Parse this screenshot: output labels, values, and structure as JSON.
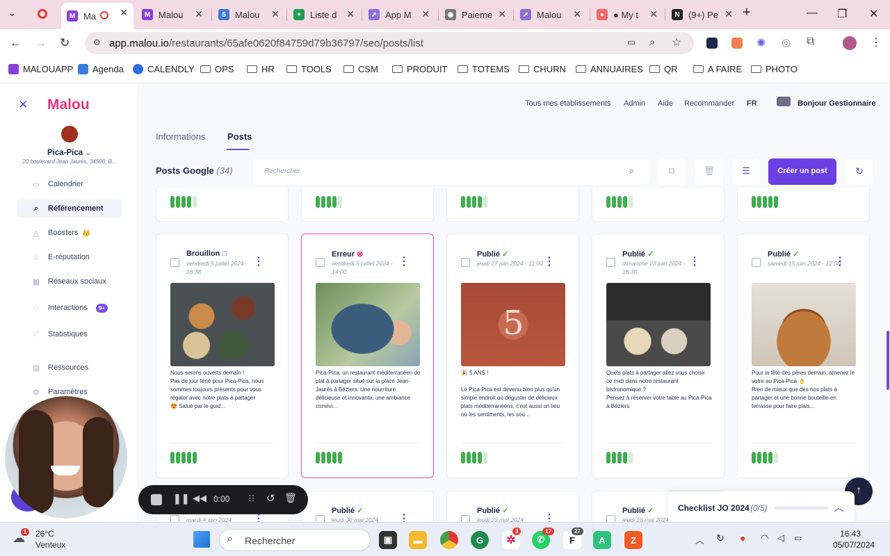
{
  "browser": {
    "tabs": [
      {
        "title": "Ma",
        "fav": "M",
        "color": "#8b3fd9",
        "active": true
      },
      {
        "title": "Malou",
        "fav": "M",
        "color": "#8b3fd9"
      },
      {
        "title": "Malou",
        "fav": "5",
        "color": "#3c7bd8"
      },
      {
        "title": "Liste d",
        "fav": "+",
        "color": "#1e9e55"
      },
      {
        "title": "App M",
        "fav": "rocket",
        "color": "#8a6fd8"
      },
      {
        "title": "Paieme",
        "fav": "globe",
        "color": "#777"
      },
      {
        "title": "Malou",
        "fav": "rocket",
        "color": "#8a6fd8"
      },
      {
        "title": "● My t",
        "fav": "asana",
        "color": "#f06a6a"
      },
      {
        "title": "(9+) Pe",
        "fav": "N",
        "color": "#222"
      }
    ],
    "url_host": "app.malou.io",
    "url_path": "/restaurants/65afe0620f84759d79b36797/seo/posts/list",
    "bookmarks": [
      "MALOUAPP",
      "Agenda",
      "CALENDLY",
      "OPS",
      "HR",
      "TOOLS",
      "CSM",
      "PRODUIT",
      "TOTEMS",
      "CHURN",
      "ANNUAIRES",
      "QR",
      "A FAIRE",
      "PHOTO"
    ]
  },
  "sidebar": {
    "logo": "Malou",
    "restaurant_name": "Pica-Pica",
    "restaurant_address": "20 boulevard Jean Jaurès, 34500, B...",
    "items": [
      {
        "label": "Calendrier",
        "icon": "calendar-icon"
      },
      {
        "label": "Référencement",
        "icon": "search-icon",
        "active": true
      },
      {
        "label": "Boosters",
        "icon": "rocket-icon",
        "crown": "👑"
      },
      {
        "label": "E-réputation",
        "icon": "star-icon"
      },
      {
        "label": "Réseaux sociaux",
        "icon": "share-icon"
      },
      {
        "label": "Interactions",
        "icon": "chat-icon",
        "badge": "9+"
      },
      {
        "label": "Statistiques",
        "icon": "chart-icon"
      },
      {
        "label": "Ressources",
        "icon": "book-icon"
      },
      {
        "label": "Paramètres",
        "icon": "settings-icon"
      }
    ]
  },
  "header": {
    "links": [
      "Tous mes établissements",
      "Admin",
      "Aide",
      "Recommander",
      "FR"
    ],
    "greeting": "Bonjour Gestionnaire",
    "tabs": [
      "Informations",
      "Posts"
    ],
    "active_tab": "Posts"
  },
  "toolbar": {
    "title": "Posts Google",
    "count": "(34)",
    "search_placeholder": "Rechercher",
    "create_label": "Créer un post"
  },
  "posts": [
    {
      "status": "Brouillon",
      "status_icon": "□",
      "date": "vendredi 5 juillet 2024 - 16:38",
      "image": "food-spread",
      "caption": "Nous serons ouverts demain !\nPas de jour férié pour Pica-Pica, nous sommes toujours présents pour vous régaler avec notre plats à partager\n😍 Salué par le guid...",
      "score": 5
    },
    {
      "status": "Erreur",
      "status_icon": "⊗",
      "date": "vendredi 5 juillet 2024 - 14:00",
      "image": "oysters",
      "caption": "Pica-Pica, un restaurant méditerranéen de plat à partager situé sur la place Jean-Jaurès à Béziers. Une nourriture délicieuse et innovante, une ambiance convivi...",
      "score": 5
    },
    {
      "status": "Publié",
      "status_icon": "✓",
      "date": "jeudi 27 juin 2024 - 11:00",
      "image": "birthday-5",
      "caption": "🎉 5 ANS !\n\nLe Pica-Pica est devenu bien plus qu'un simple endroit où déguster de délicieux plats méditerranéens, c'est aussi un lieu où les sentiments, les sou...",
      "score": 4
    },
    {
      "status": "Publié",
      "status_icon": "✓",
      "date": "dimanche 23 juin 2024 - 18:30",
      "image": "plates-bar",
      "caption": "Quels plats à partager allez vous choisir ce midi dans notre restaurant bistronomique ?\nPensez à réserver votre table au Pica-Pica à Béziers",
      "score": 4
    },
    {
      "status": "Publié",
      "status_icon": "✓",
      "date": "samedi 15 juin 2024 - 12:00",
      "image": "croquettes",
      "caption": "Pour la fête des pères demain, amenez le votre au Pica-Pica 👌\nRien de mieux que des nos plats à partager et une bonne bouteille en terrasse pour faire plais...",
      "score": 4
    }
  ],
  "top_row_scores": [
    4,
    4,
    4,
    4,
    5
  ],
  "bottom_row": [
    {
      "status": "",
      "date": "mardi 4 juin 2024"
    },
    {
      "status": "Publié",
      "date": "jeudi 30 mai 2024"
    },
    {
      "status": "Publié",
      "date": "jeudi 23 mai 2024"
    },
    {
      "status": "Publié",
      "date": "jeudi 16 mai 2024"
    }
  ],
  "checklist": {
    "label": "Checklist JO 2024",
    "count": "(0/5)"
  },
  "recorder": {
    "time": "0:00"
  },
  "taskbar": {
    "temperature": "26°C",
    "weather": "Venteux",
    "weather_badge": "1",
    "search": "Rechercher",
    "time": "16:43",
    "date": "05/07/2024",
    "badges": {
      "slack": "3",
      "whatsapp": "17",
      "other": "27"
    }
  }
}
